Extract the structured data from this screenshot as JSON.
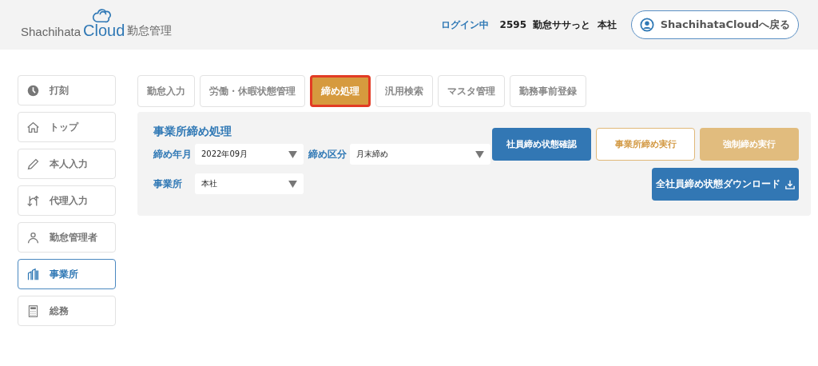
{
  "header": {
    "logo_name": "Shachihata",
    "logo_brand": "Cloud",
    "logo_app": "勤怠管理",
    "login_label": "ログイン中",
    "user_info": "2595  勤怠ササっと  本社",
    "back_button": "ShachihataCloudへ戻る"
  },
  "sidebar": {
    "items": [
      {
        "label": "打刻",
        "selected": false
      },
      {
        "label": "トップ",
        "selected": false
      },
      {
        "label": "本人入力",
        "selected": false
      },
      {
        "label": "代理入力",
        "selected": false
      },
      {
        "label": "勤怠管理者",
        "selected": false
      },
      {
        "label": "事業所",
        "selected": true
      },
      {
        "label": "総務",
        "selected": false
      }
    ]
  },
  "tabs": [
    {
      "label": "勤怠入力",
      "selected": false
    },
    {
      "label": "労働・休暇状態管理",
      "selected": false
    },
    {
      "label": "締め処理",
      "selected": true
    },
    {
      "label": "汎用検索",
      "selected": false
    },
    {
      "label": "マスタ管理",
      "selected": false
    },
    {
      "label": "勤務事前登録",
      "selected": false
    }
  ],
  "panel": {
    "title": "事業所締め処理",
    "fields": [
      {
        "label": "締め年月",
        "value": "2022年09月"
      },
      {
        "label": "締め区分",
        "value": "月末締め"
      },
      {
        "label": "事業所",
        "value": "本社"
      }
    ],
    "buttons": [
      {
        "label": "社員締め状態確認",
        "kind": "primary"
      },
      {
        "label": "事業所締め実行",
        "kind": "outline"
      },
      {
        "label": "強制締め実行",
        "kind": "disabled"
      },
      {
        "label": "全社員締め状態ダウンロード",
        "kind": "download"
      }
    ]
  }
}
